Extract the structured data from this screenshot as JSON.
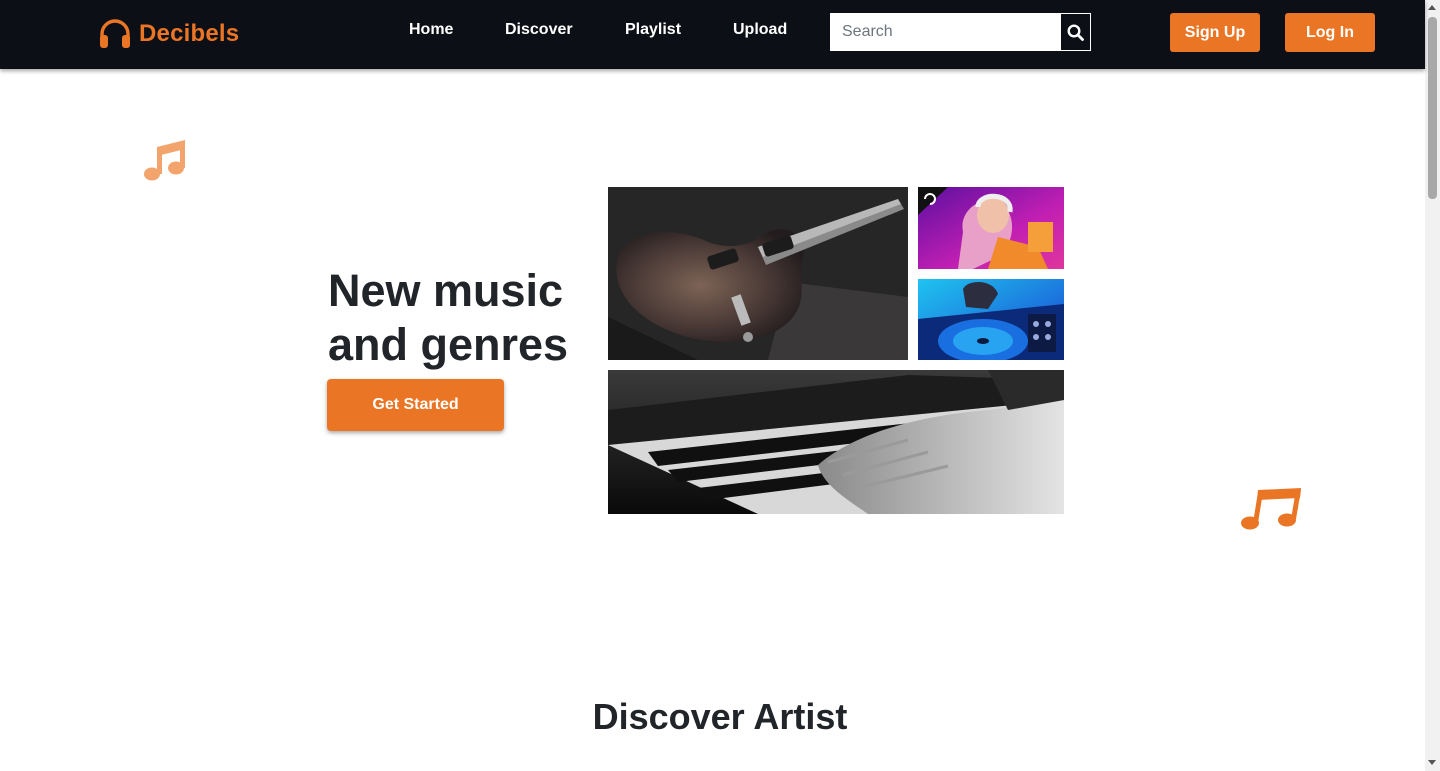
{
  "brand": {
    "name": "Decibels",
    "icon": "headphones-icon",
    "color": "#ea7625"
  },
  "nav": {
    "links": [
      {
        "label": "Home"
      },
      {
        "label": "Discover"
      },
      {
        "label": "Playlist"
      },
      {
        "label": "Upload"
      }
    ],
    "search": {
      "placeholder": "Search",
      "value": "",
      "icon": "search-icon"
    },
    "signup_label": "Sign Up",
    "login_label": "Log In"
  },
  "hero": {
    "title": "New music and genres",
    "cta_label": "Get Started",
    "images": [
      {
        "subject": "electric guitar",
        "icon": "guitar-photo"
      },
      {
        "subject": "DJ with headphones",
        "icon": "dj-photo"
      },
      {
        "subject": "DJ turntable",
        "icon": "turntable-photo"
      },
      {
        "subject": "piano keys",
        "icon": "piano-photo"
      }
    ],
    "decor_icons": [
      "music-note-icon",
      "music-note-icon"
    ]
  },
  "sections": {
    "discover_title": "Discover Artist"
  },
  "colors": {
    "accent": "#ea7625",
    "navbar_bg": "#0d0f17",
    "text": "#212529"
  }
}
